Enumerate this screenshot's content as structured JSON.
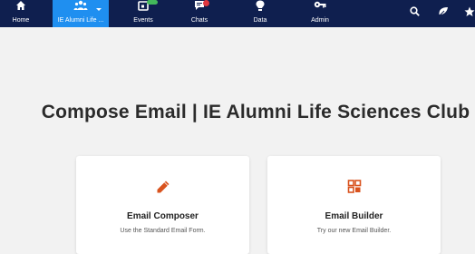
{
  "nav": {
    "items": [
      {
        "label": "Home",
        "icon": "home-icon"
      },
      {
        "label": "IE Alumni Life ...",
        "icon": "group-icon",
        "active": true
      },
      {
        "label": "Events",
        "icon": "calendar-icon"
      },
      {
        "label": "Chats",
        "icon": "chat-icon"
      },
      {
        "label": "Data",
        "icon": "lightbulb-icon"
      },
      {
        "label": "Admin",
        "icon": "key-icon"
      }
    ],
    "utility_icons": [
      "search-icon",
      "leaf-icon",
      "star-icon"
    ],
    "colors": {
      "bar": "#0f1f4f",
      "active": "#1f8ff0",
      "badge_green": "#43b85b",
      "badge_red": "#e0373e"
    }
  },
  "page": {
    "title": "Compose Email | IE Alumni Life Sciences Club"
  },
  "cards": [
    {
      "title": "Email Composer",
      "description": "Use the Standard Email Form.",
      "icon": "pencil-icon"
    },
    {
      "title": "Email Builder",
      "description": "Try our new Email Builder.",
      "icon": "grid-layout-icon"
    }
  ],
  "accent_color": "#d9531e"
}
